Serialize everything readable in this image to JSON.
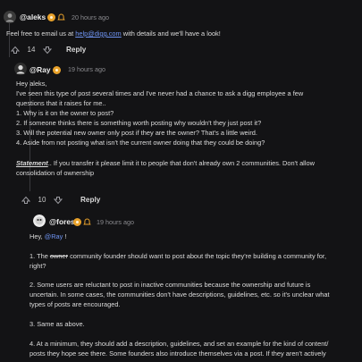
{
  "comment1": {
    "username": "@aleks",
    "timestamp": "20 hours ago",
    "text_before": "Feel free to email us at ",
    "email": "help@digg.com",
    "text_after": " with details and we'll have a look!",
    "votes": "14",
    "reply_label": "Reply"
  },
  "comment2": {
    "username": "@Ray",
    "timestamp": "19 hours ago",
    "lines": [
      "Hey aleks,",
      "I've seen this type of post several times and I've never had a chance to ask a digg employee a few",
      "questions that it raises for me..",
      "1. Why is it on the owner to post?",
      "2. If someone thinks there is something worth posting why wouldn't they just post it?",
      "3. Will the potential new owner only post if they are the owner? That's a little weird.",
      "4. Aside from not posting what isn't the current owner doing that they could be doing?"
    ],
    "statement_label": "Statement",
    "statement_rest": ".. If you transfer it please limit it to people that don't already own 2 communities. Don't allow",
    "statement_line2": "consolidation of ownership",
    "votes": "10",
    "reply_label": "Reply"
  },
  "comment3": {
    "username": "@forest",
    "timestamp": "19 hours ago",
    "greeting_before": "Hey, ",
    "greeting_mention": "@Ray",
    "greeting_after": " !",
    "p1_prefix": "1. The ",
    "p1_strike": "owner",
    "p1_rest": " community founder should want to post about the topic they're building a community for,",
    "p1_line2": "right?",
    "p2_lines": [
      "2. Some users are reluctant to post in inactive communities because the ownership and future is",
      "uncertain. In some cases, the communities don't have descriptions, guidelines, etc. so it's unclear what",
      "types of posts are encouraged."
    ],
    "p3": "3. Same as above.",
    "p4_lines": [
      "4. At a minimum, they should add a description, guidelines, and set an example for the kind of content/",
      "posts they hope see there. Some founders also introduce themselves via a post. If they aren't actively"
    ]
  },
  "colors": {
    "background": "#131315",
    "link": "#6f94f3",
    "badge_gold": "#e9a22b",
    "badge_bell": "#e9a22b"
  },
  "icons": [
    "upvote-icon",
    "downvote-icon",
    "gold-badge-icon",
    "bell-badge-icon"
  ]
}
